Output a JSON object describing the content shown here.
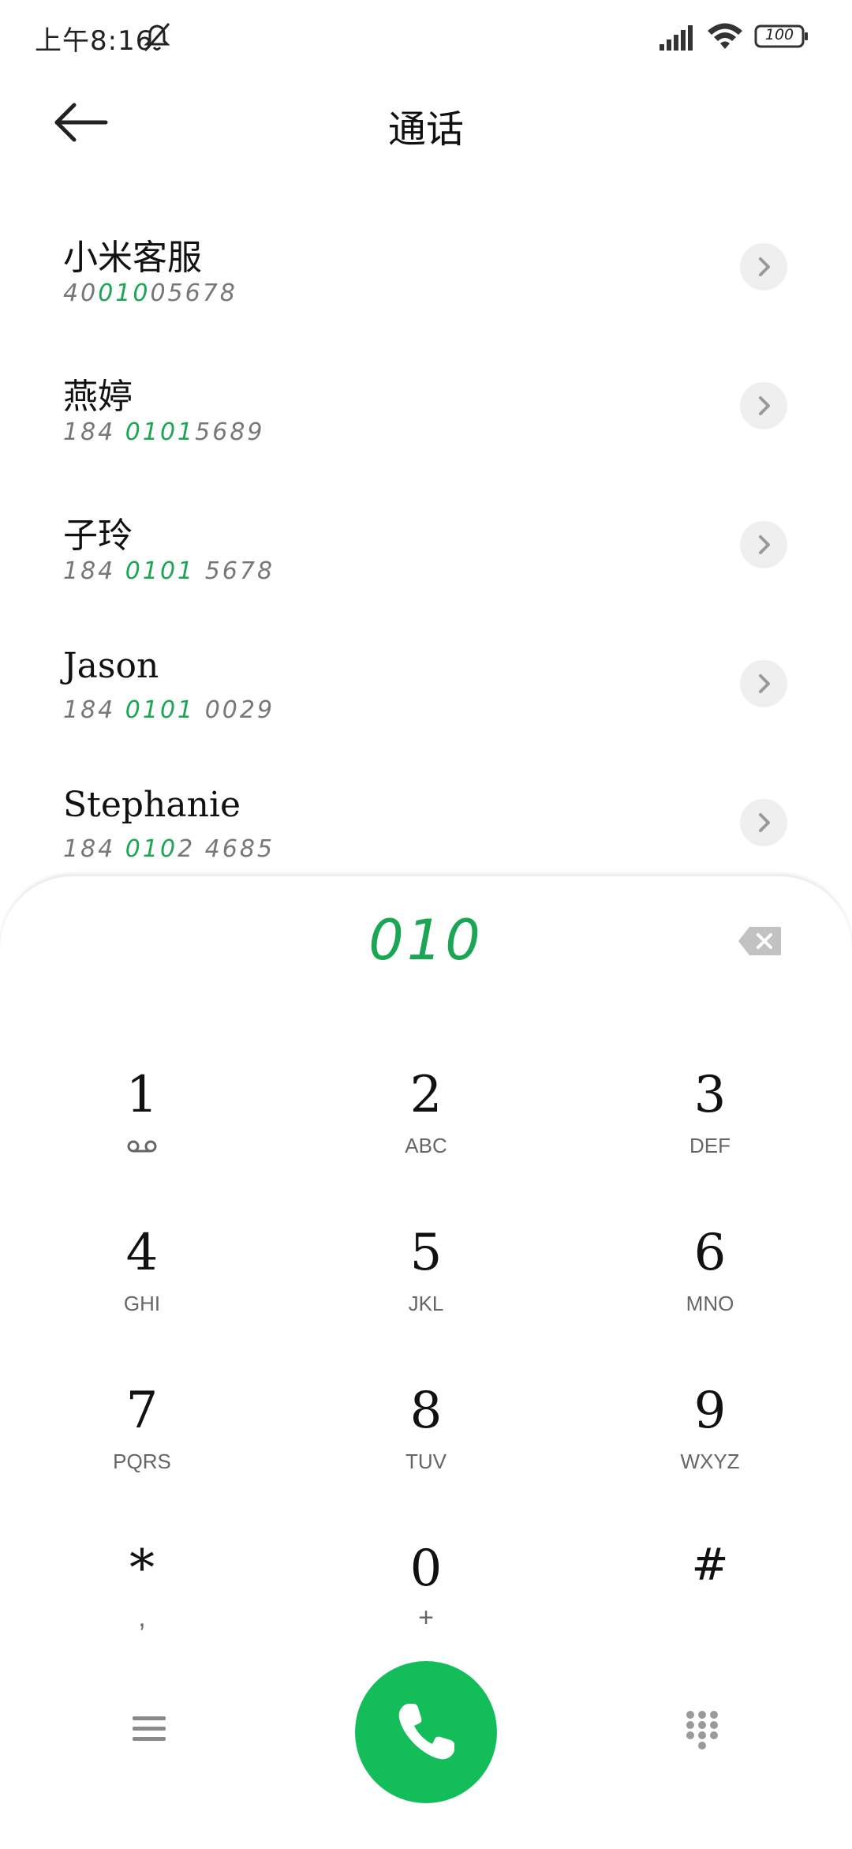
{
  "status_bar": {
    "time": "上午8:16",
    "battery": "100",
    "icons": [
      "bell-off-icon",
      "signal-icon",
      "wifi-icon",
      "battery-icon"
    ]
  },
  "header": {
    "title": "通话",
    "back_icon": "back-arrow-icon"
  },
  "contacts": [
    {
      "name": "小米客服",
      "number_pre": "40",
      "number_match": "010",
      "number_post": "05678"
    },
    {
      "name": "燕婷",
      "number_pre": "184 ",
      "number_match": "0101",
      "number_post": "5689"
    },
    {
      "name": "子玲",
      "number_pre": "184 ",
      "number_match": "0101",
      "number_post": " 5678"
    },
    {
      "name": "Jason",
      "number_pre": "184 ",
      "number_match": "0101",
      "number_post": " 0029"
    },
    {
      "name": "Stephanie",
      "number_pre": "184 ",
      "number_match": "010",
      "number_post": "2 4685"
    }
  ],
  "dialer": {
    "input": "010",
    "keys": [
      {
        "digit": "1",
        "letters": ""
      },
      {
        "digit": "2",
        "letters": "ABC"
      },
      {
        "digit": "3",
        "letters": "DEF"
      },
      {
        "digit": "4",
        "letters": "GHI"
      },
      {
        "digit": "5",
        "letters": "JKL"
      },
      {
        "digit": "6",
        "letters": "MNO"
      },
      {
        "digit": "7",
        "letters": "PQRS"
      },
      {
        "digit": "8",
        "letters": "TUV"
      },
      {
        "digit": "9",
        "letters": "WXYZ"
      },
      {
        "digit": "*",
        "letters": ","
      },
      {
        "digit": "0",
        "letters": "+"
      },
      {
        "digit": "#",
        "letters": ""
      }
    ]
  },
  "colors": {
    "accent_green": "#1aa653",
    "call_button": "#13bd5a"
  }
}
